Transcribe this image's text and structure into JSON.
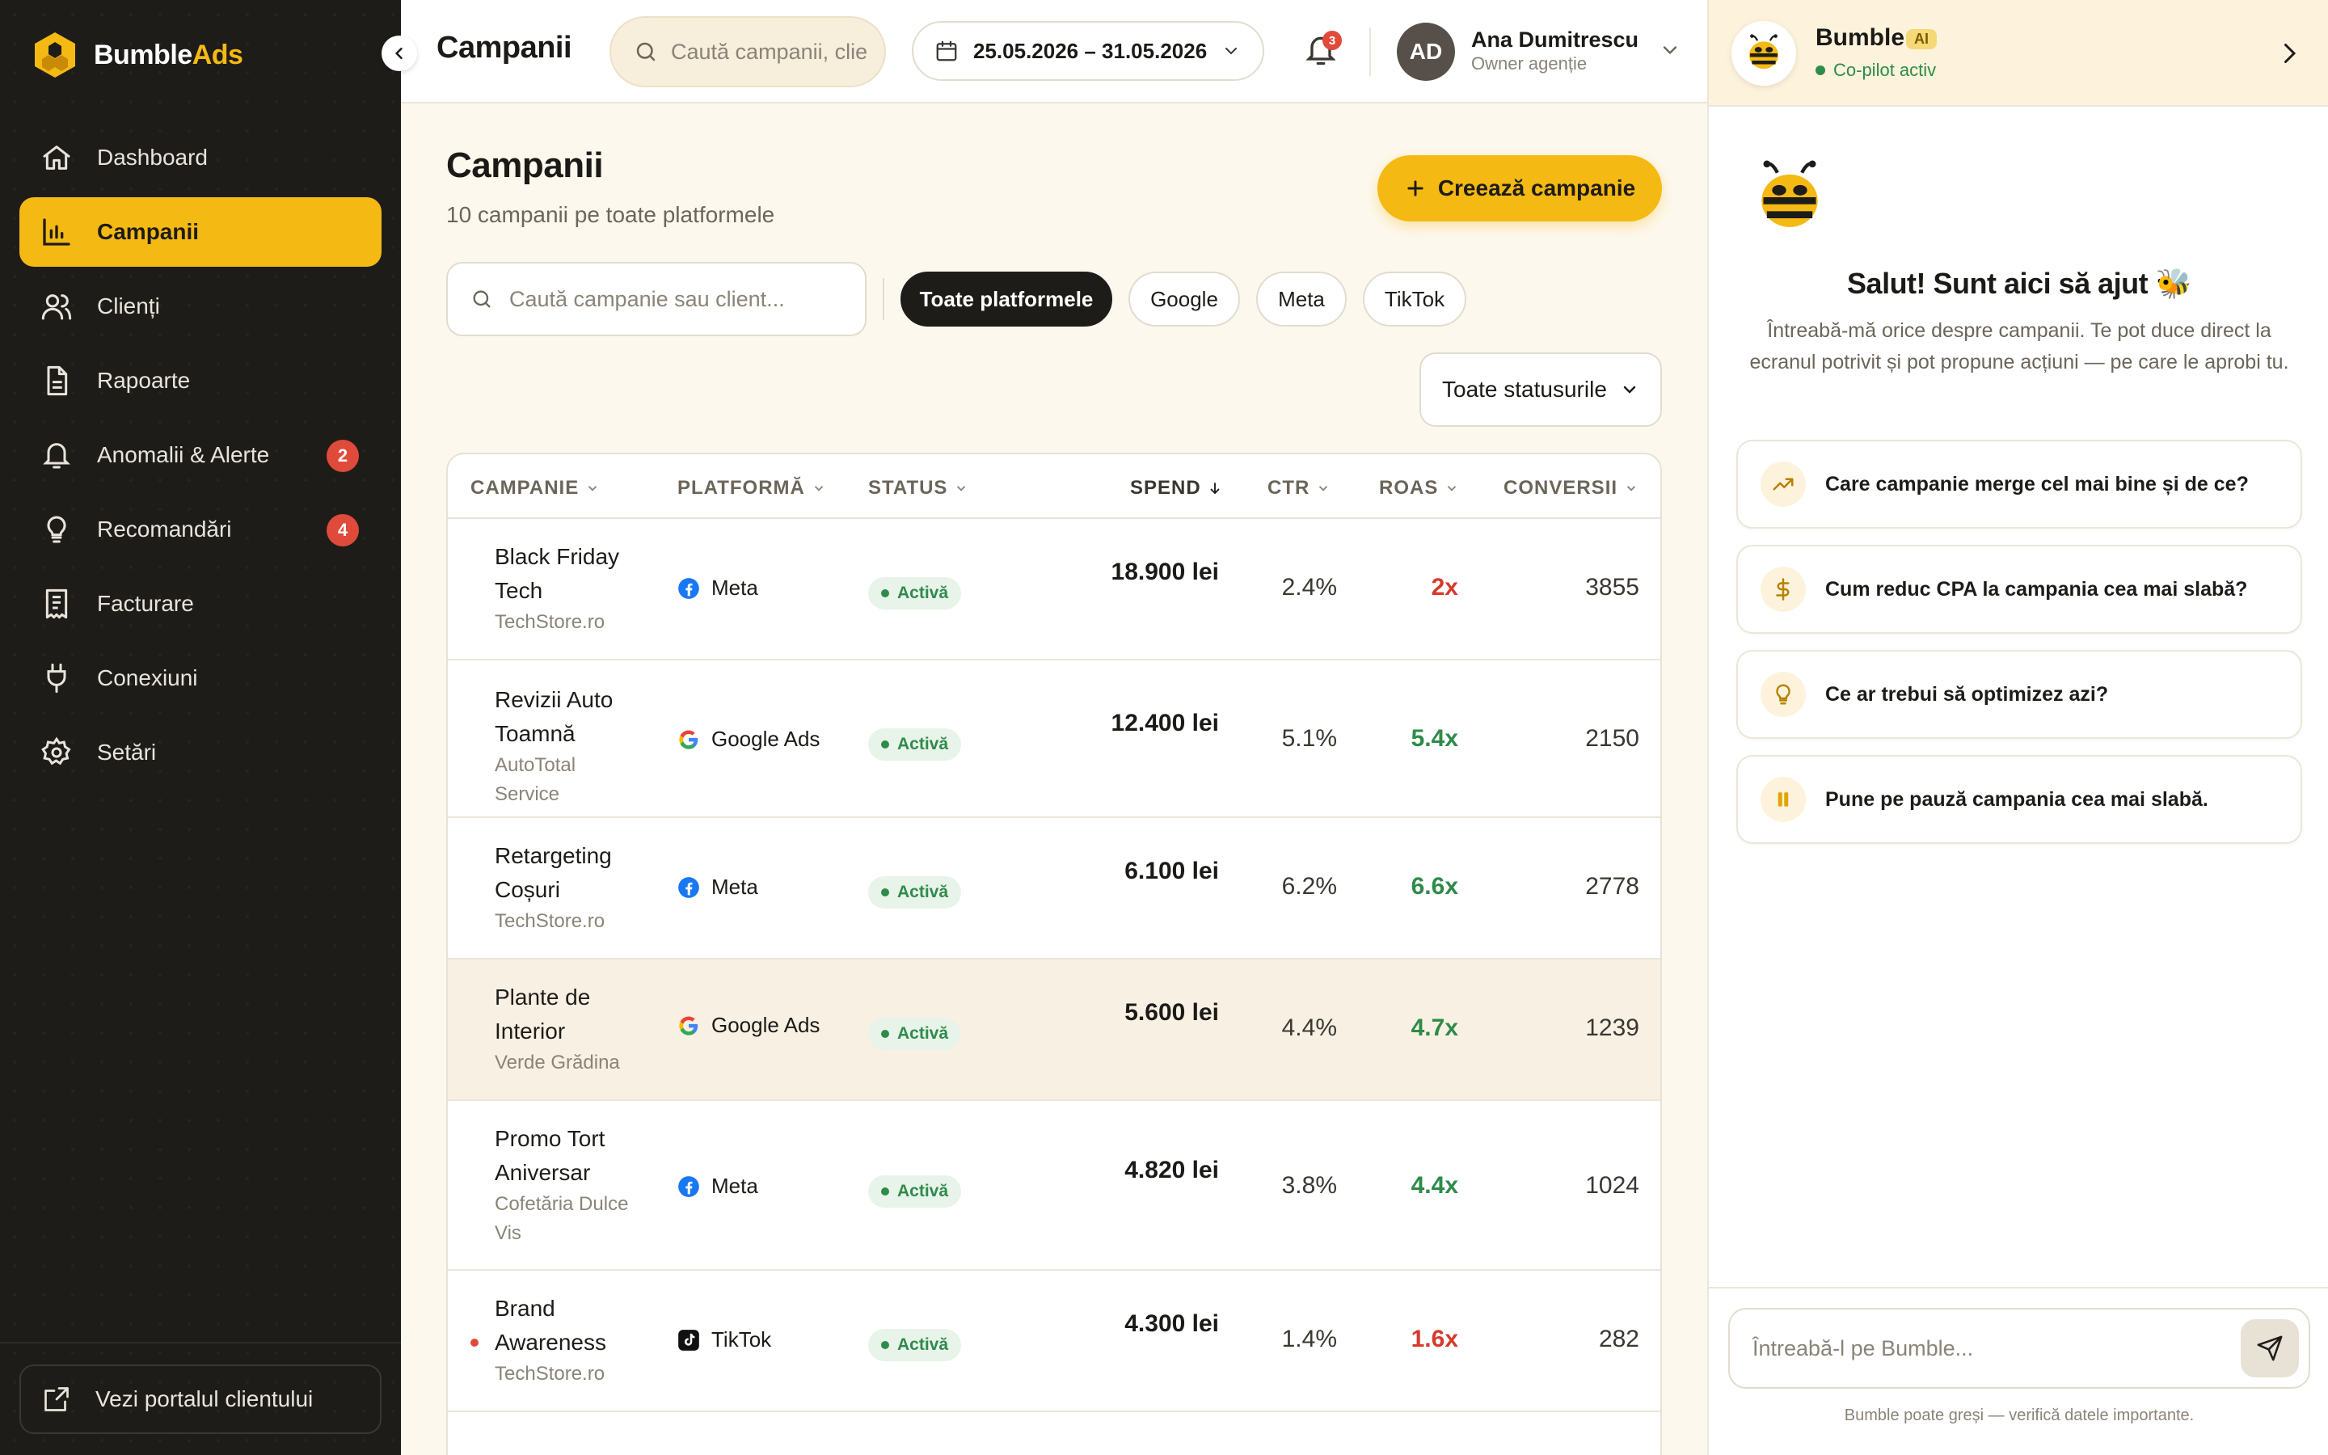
{
  "brand": {
    "name_prefix": "Bumble",
    "name_accent": "Ads"
  },
  "sidebar": {
    "items": [
      {
        "label": "Dashboard",
        "icon": "home-icon",
        "active": false
      },
      {
        "label": "Campanii",
        "icon": "bar-chart-icon",
        "active": true
      },
      {
        "label": "Clienți",
        "icon": "users-icon",
        "active": false
      },
      {
        "label": "Rapoarte",
        "icon": "document-icon",
        "active": false
      },
      {
        "label": "Anomalii & Alerte",
        "icon": "bell-icon",
        "active": false,
        "badge": "2"
      },
      {
        "label": "Recomandări",
        "icon": "lightbulb-icon",
        "active": false,
        "badge": "4"
      },
      {
        "label": "Facturare",
        "icon": "receipt-icon",
        "active": false
      },
      {
        "label": "Conexiuni",
        "icon": "plug-icon",
        "active": false
      },
      {
        "label": "Setări",
        "icon": "gear-icon",
        "active": false
      }
    ],
    "portal_link": "Vezi portalul clientului"
  },
  "topbar": {
    "title": "Campanii",
    "search_placeholder": "Caută campanii, clie",
    "date_range": "25.05.2026 – 31.05.2026",
    "notifications_count": "3",
    "user": {
      "initials": "AD",
      "name": "Ana Dumitrescu",
      "role": "Owner agenție"
    }
  },
  "main": {
    "title": "Campanii",
    "subtitle": "10 campanii pe toate platformele",
    "create_button": "Creează campanie",
    "search_placeholder": "Caută campanie sau client...",
    "platform_filters": [
      "Toate platformele",
      "Google",
      "Meta",
      "TikTok"
    ],
    "active_platform_filter": "Toate platformele",
    "status_filter": "Toate statusurile",
    "columns": [
      "CAMPANIE",
      "PLATFORMĂ",
      "STATUS",
      "SPEND",
      "CTR",
      "ROAS",
      "CONVERSII"
    ],
    "sorted_column": "SPEND",
    "rows": [
      {
        "name": "Black Friday Tech",
        "client": "TechStore.ro",
        "platform": "Meta",
        "status": "Activă",
        "spend": "18.900 lei",
        "ctr": "2.4%",
        "roas": "2x",
        "roas_state": "bad",
        "conversions": "3855"
      },
      {
        "name": "Revizii Auto Toamnă",
        "client": "AutoTotal Service",
        "platform": "Google Ads",
        "status": "Activă",
        "spend": "12.400 lei",
        "ctr": "5.1%",
        "roas": "5.4x",
        "roas_state": "good",
        "conversions": "2150"
      },
      {
        "name": "Retargeting Coșuri",
        "client": "TechStore.ro",
        "platform": "Meta",
        "status": "Activă",
        "spend": "6.100 lei",
        "ctr": "6.2%",
        "roas": "6.6x",
        "roas_state": "good",
        "conversions": "2778"
      },
      {
        "name": "Plante de Interior",
        "client": "Verde Grădina",
        "platform": "Google Ads",
        "status": "Activă",
        "spend": "5.600 lei",
        "ctr": "4.4%",
        "roas": "4.7x",
        "roas_state": "good",
        "conversions": "1239"
      },
      {
        "name": "Promo Tort Aniversar",
        "client": "Cofetăria Dulce Vis",
        "platform": "Meta",
        "status": "Activă",
        "spend": "4.820 lei",
        "ctr": "3.8%",
        "roas": "4.4x",
        "roas_state": "good",
        "conversions": "1024"
      },
      {
        "name": "Brand Awareness",
        "client": "TechStore.ro",
        "platform": "TikTok",
        "status": "Activă",
        "spend": "4.300 lei",
        "ctr": "1.4%",
        "roas": "1.6x",
        "roas_state": "bad",
        "conversions": "282"
      }
    ]
  },
  "ai_panel": {
    "name": "Bumble",
    "tag": "AI",
    "status": "Co-pilot activ",
    "greeting": "Salut! Sunt aici să ajut 🐝",
    "intro": "Întreabă-mă orice despre campanii. Te pot duce direct la ecranul potrivit și pot propune acțiuni — pe care le aprobi tu.",
    "suggestions": [
      {
        "label": "Care campanie merge cel mai bine și de ce?",
        "icon": "trending-up-icon"
      },
      {
        "label": "Cum reduc CPA la campania cea mai slabă?",
        "icon": "dollar-icon"
      },
      {
        "label": "Ce ar trebui să optimizez azi?",
        "icon": "lightbulb-icon"
      },
      {
        "label": "Pune pe pauză campania cea mai slabă.",
        "icon": "pause-icon"
      }
    ],
    "input_placeholder": "Întreabă-l pe Bumble...",
    "disclaimer": "Bumble poate greși — verifică datele importante."
  },
  "colors": {
    "accent": "#f5b914",
    "sidebar": "#1e1c19",
    "good": "#2e8b4a",
    "bad": "#d63a2c",
    "badge": "#e04a3a"
  }
}
